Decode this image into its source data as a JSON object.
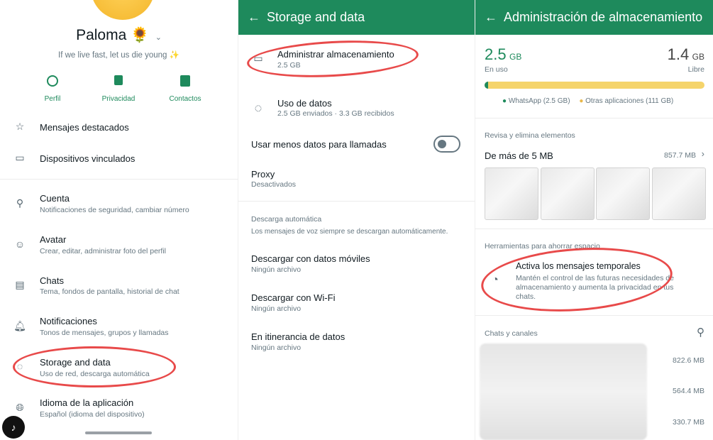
{
  "profile": {
    "name": "Paloma 🌻",
    "status": "If we live fast, let us die young ✨",
    "actions": [
      {
        "label": "Perfil",
        "icon": "profile-icon"
      },
      {
        "label": "Privacidad",
        "icon": "lock-icon"
      },
      {
        "label": "Contactos",
        "icon": "contacts-icon"
      }
    ]
  },
  "settings": {
    "items": [
      {
        "title": "Mensajes destacados",
        "icon": "star-icon"
      },
      {
        "title": "Dispositivos vinculados",
        "icon": "devices-icon"
      },
      {
        "title": "Cuenta",
        "sub": "Notificaciones de seguridad, cambiar número",
        "icon": "key-icon"
      },
      {
        "title": "Avatar",
        "sub": "Crear, editar, administrar foto del perfil",
        "icon": "avatar-icon"
      },
      {
        "title": "Chats",
        "sub": "Tema, fondos de pantalla, historial de chat",
        "icon": "chat-icon"
      },
      {
        "title": "Notificaciones",
        "sub": "Tonos de mensajes, grupos y llamadas",
        "icon": "bell-icon"
      },
      {
        "title": "Storage and data",
        "sub": "Uso de red, descarga automática",
        "icon": "data-icon"
      },
      {
        "title": "Idioma de la aplicación",
        "sub": "Español (idioma del dispositivo)",
        "icon": "globe-icon"
      }
    ]
  },
  "storage_data": {
    "title": "Storage and data",
    "manage": {
      "title": "Administrar almacenamiento",
      "sub": "2.5 GB"
    },
    "usage": {
      "title": "Uso de datos",
      "sub": "2.5 GB enviados · 3.3 GB recibidos"
    },
    "less_data": {
      "title": "Usar menos datos para llamadas",
      "on": false
    },
    "proxy": {
      "title": "Proxy",
      "sub": "Desactivados"
    },
    "auto_section": "Descarga automática",
    "auto_note": "Los mensajes de voz siempre se descargan automáticamente.",
    "mobile": {
      "title": "Descargar con datos móviles",
      "sub": "Ningún archivo"
    },
    "wifi": {
      "title": "Descargar con Wi-Fi",
      "sub": "Ningún archivo"
    },
    "roaming": {
      "title": "En itinerancia de datos",
      "sub": "Ningún archivo"
    }
  },
  "manage_storage": {
    "title": "Administración de almacenamiento",
    "used_value": "2.5",
    "used_unit": "GB",
    "used_label": "En uso",
    "free_value": "1.4",
    "free_unit": "GB",
    "free_label": "Libre",
    "whatsapp_fraction": 0.017,
    "legend_whatsapp": "WhatsApp (2.5 GB)",
    "legend_other": "Otras aplicaciones (111 GB)",
    "review_section": "Revisa y elimina elementos",
    "large_files": {
      "title": "De más de 5 MB",
      "size": "857.7 MB"
    },
    "tools_section": "Herramientas para ahorrar espacio",
    "temp_messages": {
      "title": "Activa los mensajes temporales",
      "sub": "Mantén el control de las futuras necesidades de almacenamiento y aumenta la privacidad en tus chats."
    },
    "chats_section": "Chats y canales",
    "chat_sizes": [
      "822.6 MB",
      "564.4 MB",
      "330.7 MB"
    ]
  },
  "colors": {
    "accent": "#1e8a5c",
    "bar_whatsapp": "#1e8a5c",
    "bar_other": "#f5d46b",
    "annotation": "#e84a4a"
  }
}
